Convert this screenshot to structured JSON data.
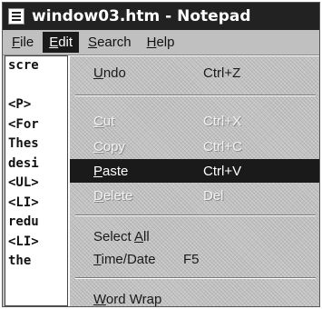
{
  "window": {
    "title": "window03.htm - Notepad"
  },
  "menubar": {
    "file": {
      "underline": "F",
      "rest": "ile"
    },
    "edit": {
      "underline": "E",
      "rest": "dit"
    },
    "search": {
      "underline": "S",
      "rest": "earch"
    },
    "help": {
      "underline": "H",
      "rest": "elp"
    }
  },
  "editor": {
    "lines": [
      "scre",
      "",
      "<P>",
      "<For",
      "Thes",
      "desi",
      "<UL>",
      "<LI>",
      "redu",
      "<LI>",
      "the"
    ]
  },
  "edit_menu": {
    "undo": {
      "underline": "U",
      "rest": "ndo",
      "shortcut": "Ctrl+Z"
    },
    "cut": {
      "underline": "C",
      "rest": "ut",
      "shortcut": "Ctrl+X"
    },
    "copy": {
      "underline": "C",
      "rest": "opy",
      "shortcut": "Ctrl+C"
    },
    "paste": {
      "underline": "P",
      "rest": "aste",
      "shortcut": "Ctrl+V"
    },
    "delete": {
      "underline": "D",
      "rest": "elete",
      "shortcut": "Del"
    },
    "select_all": {
      "before": "Select ",
      "underline": "A",
      "rest": "ll"
    },
    "time_date": {
      "underline": "T",
      "rest": "ime/Date",
      "shortcut": "F5"
    },
    "word_wrap": {
      "underline": "W",
      "rest": "ord Wrap"
    }
  }
}
